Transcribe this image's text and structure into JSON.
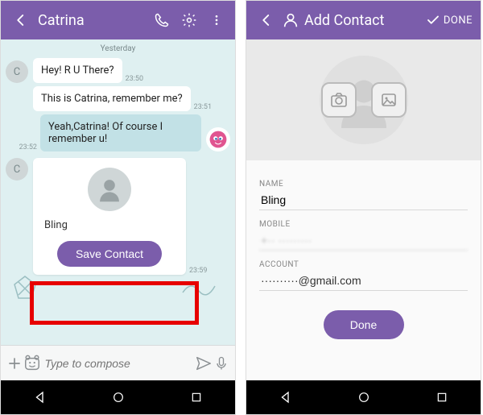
{
  "left": {
    "header": {
      "title": "Catrina",
      "back_icon": "chevron-left",
      "actions": [
        "phone",
        "settings",
        "overflow"
      ]
    },
    "date_separator": "Yesterday",
    "messages": [
      {
        "dir": "in",
        "avatar_initial": "C",
        "text": "Hey! R U There?",
        "time": "23:50"
      },
      {
        "dir": "in",
        "avatar_initial": "",
        "text": "This is Catrina, remember me?",
        "time": "23:51"
      },
      {
        "dir": "out",
        "text": "Yeah,Catrina! Of course I remember u!",
        "time": "23:52"
      }
    ],
    "contact_card": {
      "name": "Bling",
      "button_label": "Save Contact",
      "time": "23:59"
    },
    "composer": {
      "placeholder": "Type to compose"
    }
  },
  "right": {
    "header": {
      "title": "Add Contact",
      "done_label": "DONE"
    },
    "fields": {
      "name": {
        "label": "NAME",
        "value": "Bling"
      },
      "mobile": {
        "label": "MOBILE",
        "value": "+·· ·········"
      },
      "account": {
        "label": "ACCOUNT",
        "value": "··········@gmail.com"
      }
    },
    "done_button": "Done"
  },
  "nav": {
    "back": "back",
    "home": "home",
    "recents": "recents"
  }
}
